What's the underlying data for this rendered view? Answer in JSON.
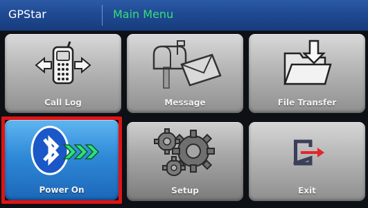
{
  "header": {
    "app_name": "GPStar",
    "screen_title": "Main Menu"
  },
  "menu": {
    "items": [
      {
        "label": "Call Log",
        "icon": "phone-transfer-icon"
      },
      {
        "label": "Message",
        "icon": "mailbox-envelope-icon"
      },
      {
        "label": "File Transfer",
        "icon": "folder-download-icon"
      },
      {
        "label": "Power On",
        "icon": "bluetooth-icon",
        "selected": true
      },
      {
        "label": "Setup",
        "icon": "gears-icon"
      },
      {
        "label": "Exit",
        "icon": "exit-icon"
      }
    ]
  },
  "colors": {
    "header_bg": "#1f4a93",
    "title_accent": "#35e07a",
    "selection_border": "#e01414",
    "selected_tile": "#2f8ad8"
  }
}
